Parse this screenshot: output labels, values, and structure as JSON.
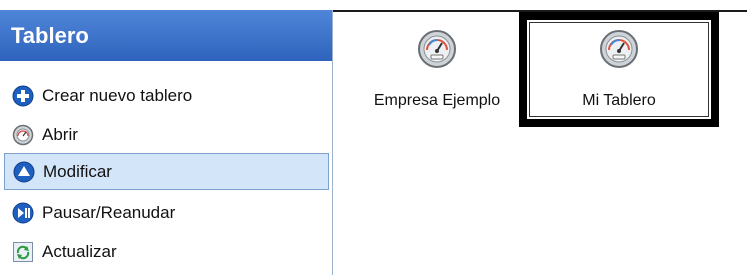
{
  "sidebar": {
    "title": "Tablero",
    "tasks": [
      {
        "label": "Crear nuevo tablero",
        "icon": "add-circle-icon"
      },
      {
        "label": "Abrir",
        "icon": "gauge-icon"
      },
      {
        "label": "Modificar",
        "icon": "up-arrow-circle-icon",
        "selected": true
      },
      {
        "label": "Pausar/Reanudar",
        "icon": "pause-play-icon"
      },
      {
        "label": "Actualizar",
        "icon": "refresh-icon"
      }
    ]
  },
  "dashboards": {
    "items": [
      {
        "label": "Empresa Ejemplo",
        "icon": "gauge-icon"
      },
      {
        "label": "Mi Tablero",
        "icon": "gauge-icon",
        "selected": true
      }
    ]
  },
  "colors": {
    "header": "#3a70c8",
    "selection_bg": "#d3e5f8",
    "selection_border": "#7da2ce",
    "icon_blue": "#1f5fbf"
  }
}
